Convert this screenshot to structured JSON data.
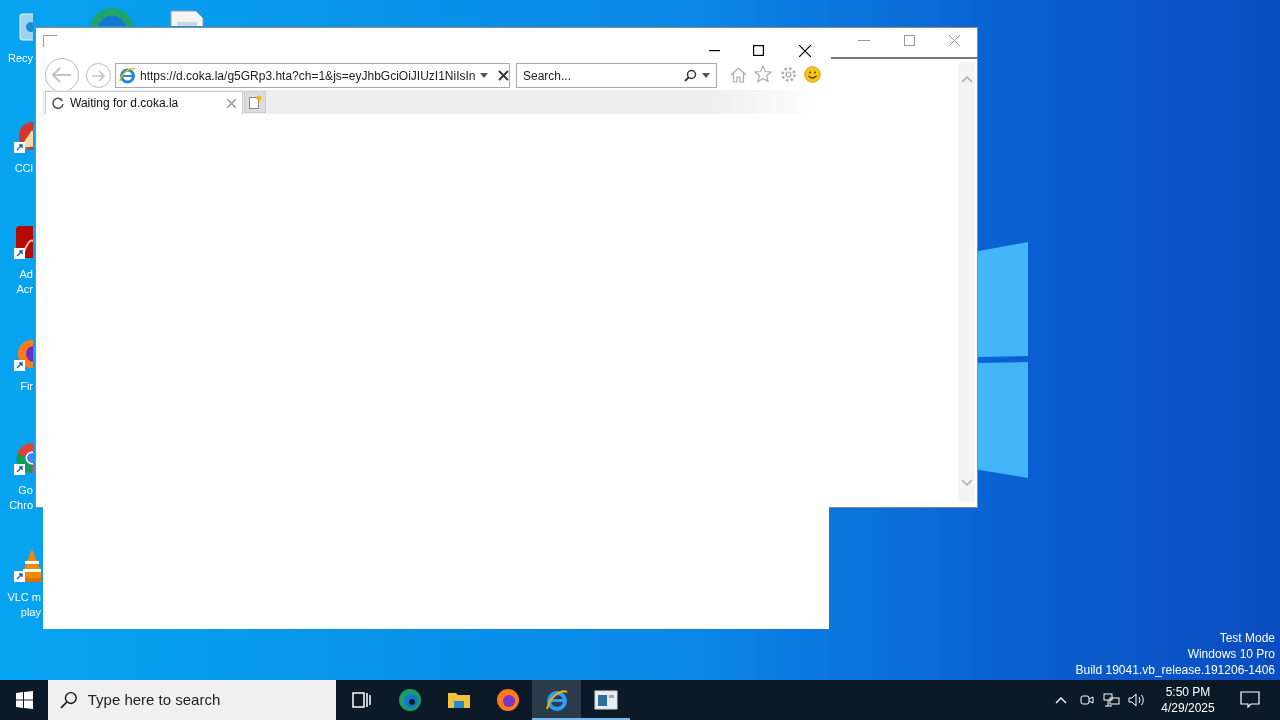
{
  "desktop": {
    "icons": [
      {
        "kind": "recycle",
        "lines": [
          "Recy"
        ]
      },
      {
        "kind": "ccleaner",
        "lines": [
          "CCl"
        ]
      },
      {
        "kind": "acrobat",
        "lines": [
          "Ad",
          "Acr"
        ]
      },
      {
        "kind": "firefox",
        "lines": [
          "Fir"
        ]
      },
      {
        "kind": "chrome",
        "lines": [
          "Go",
          "Chro"
        ]
      },
      {
        "kind": "vlc",
        "lines": [
          "VLC m",
          "play"
        ]
      }
    ],
    "system_text": [
      "Test Mode",
      "Windows 10 Pro",
      "Build 19041.vb_release.191206-1406"
    ]
  },
  "browser": {
    "address": "https://d.coka.la/g5GRp3.hta?ch=1&js=eyJhbGciOiJIUzI1NiIsIn",
    "search": {
      "placeholder": "Search..."
    },
    "tabs": [
      {
        "label": "Waiting for d.coka.la",
        "selected": true
      }
    ]
  },
  "taskbar": {
    "search": {
      "placeholder": "Type here to search"
    },
    "apps": [
      {
        "kind": "taskview",
        "selected": false,
        "running": false
      },
      {
        "kind": "edge",
        "selected": false,
        "running": false
      },
      {
        "kind": "explorer",
        "selected": false,
        "running": false
      },
      {
        "kind": "firefox",
        "selected": false,
        "running": false
      },
      {
        "kind": "ie",
        "selected": true,
        "running": true
      },
      {
        "kind": "window",
        "selected": false,
        "running": true
      }
    ],
    "time": "5:50 PM",
    "date": "4/29/2025"
  }
}
